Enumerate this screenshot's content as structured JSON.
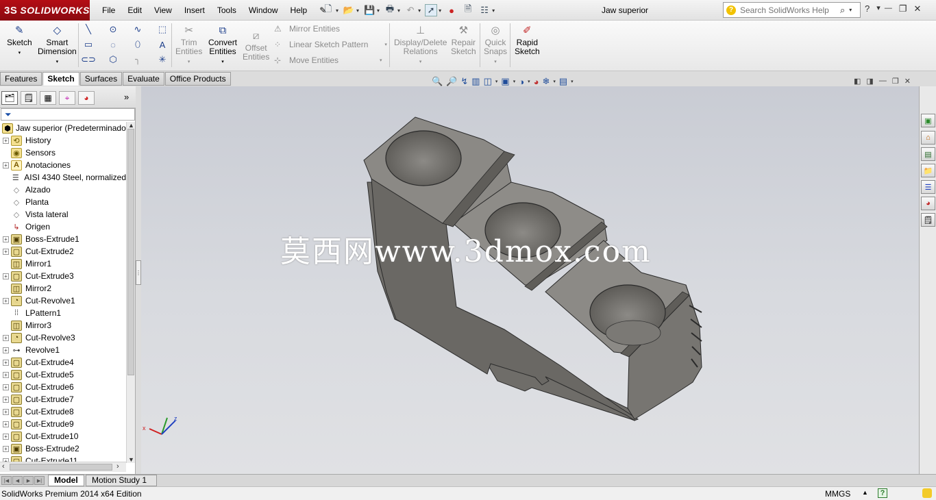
{
  "app": {
    "logo": "SOLIDWORKS",
    "logo_mark": "3S",
    "doc_title": "Jaw superior"
  },
  "menu": [
    "File",
    "Edit",
    "View",
    "Insert",
    "Tools",
    "Window",
    "Help"
  ],
  "search": {
    "placeholder": "Search SolidWorks Help"
  },
  "ribbon": {
    "sketch": "Sketch",
    "smart_dimension": [
      "Smart",
      "Dimension"
    ],
    "trim": [
      "Trim",
      "Entities"
    ],
    "convert": [
      "Convert",
      "Entities"
    ],
    "offset": [
      "Offset",
      "Entities"
    ],
    "mirror": "Mirror Entities",
    "linear_pattern": "Linear Sketch Pattern",
    "move": "Move Entities",
    "display_delete": [
      "Display/Delete",
      "Relations"
    ],
    "repair": [
      "Repair",
      "Sketch"
    ],
    "quick_snaps": [
      "Quick",
      "Snaps"
    ],
    "rapid_sketch": [
      "Rapid",
      "Sketch"
    ]
  },
  "tabs": [
    "Features",
    "Sketch",
    "Surfaces",
    "Evaluate",
    "Office Products"
  ],
  "active_tab": "Sketch",
  "tree": {
    "root": "Jaw superior  (Predeterminado",
    "items": [
      {
        "label": "History",
        "icon": "history-icon",
        "expand": true
      },
      {
        "label": "Sensors",
        "icon": "sensor-icon",
        "expand": false
      },
      {
        "label": "Anotaciones",
        "icon": "annotation-icon",
        "expand": true
      },
      {
        "label": "AISI 4340 Steel, normalized",
        "icon": "material-icon",
        "expand": false
      },
      {
        "label": "Alzado",
        "icon": "plane-icon",
        "expand": false
      },
      {
        "label": "Planta",
        "icon": "plane-icon",
        "expand": false
      },
      {
        "label": "Vista lateral",
        "icon": "plane-icon",
        "expand": false
      },
      {
        "label": "Origen",
        "icon": "origin-icon",
        "expand": false
      },
      {
        "label": "Boss-Extrude1",
        "icon": "extrude-icon",
        "expand": true
      },
      {
        "label": "Cut-Extrude2",
        "icon": "cut-icon",
        "expand": true
      },
      {
        "label": "Mirror1",
        "icon": "mirror-icon",
        "expand": false
      },
      {
        "label": "Cut-Extrude3",
        "icon": "cut-icon",
        "expand": true
      },
      {
        "label": "Mirror2",
        "icon": "mirror-icon",
        "expand": false
      },
      {
        "label": "Cut-Revolve1",
        "icon": "revolve-cut-icon",
        "expand": true
      },
      {
        "label": "LPattern1",
        "icon": "pattern-icon",
        "expand": false
      },
      {
        "label": "Mirror3",
        "icon": "mirror-icon",
        "expand": false
      },
      {
        "label": "Cut-Revolve3",
        "icon": "revolve-cut-icon",
        "expand": true
      },
      {
        "label": "Revolve1",
        "icon": "revolve-icon",
        "expand": true
      },
      {
        "label": "Cut-Extrude4",
        "icon": "cut-icon",
        "expand": true
      },
      {
        "label": "Cut-Extrude5",
        "icon": "cut-icon",
        "expand": true
      },
      {
        "label": "Cut-Extrude6",
        "icon": "cut-icon",
        "expand": true
      },
      {
        "label": "Cut-Extrude7",
        "icon": "cut-icon",
        "expand": true
      },
      {
        "label": "Cut-Extrude8",
        "icon": "cut-icon",
        "expand": true
      },
      {
        "label": "Cut-Extrude9",
        "icon": "cut-icon",
        "expand": true
      },
      {
        "label": "Cut-Extrude10",
        "icon": "cut-icon",
        "expand": true
      },
      {
        "label": "Boss-Extrude2",
        "icon": "extrude-icon",
        "expand": true
      },
      {
        "label": "Cut-Extrude11",
        "icon": "cut-icon",
        "expand": true
      }
    ]
  },
  "watermark": "莫西网www.3dmox.com",
  "bottom_tabs": [
    "Model",
    "Motion Study 1"
  ],
  "status": {
    "text": "SolidWorks Premium 2014 x64 Edition",
    "units": "MMGS"
  },
  "colors": {
    "logo_red": "#a00d14",
    "part_gray": "#6e6c68",
    "viewport_bg": "#cfd1d7"
  }
}
